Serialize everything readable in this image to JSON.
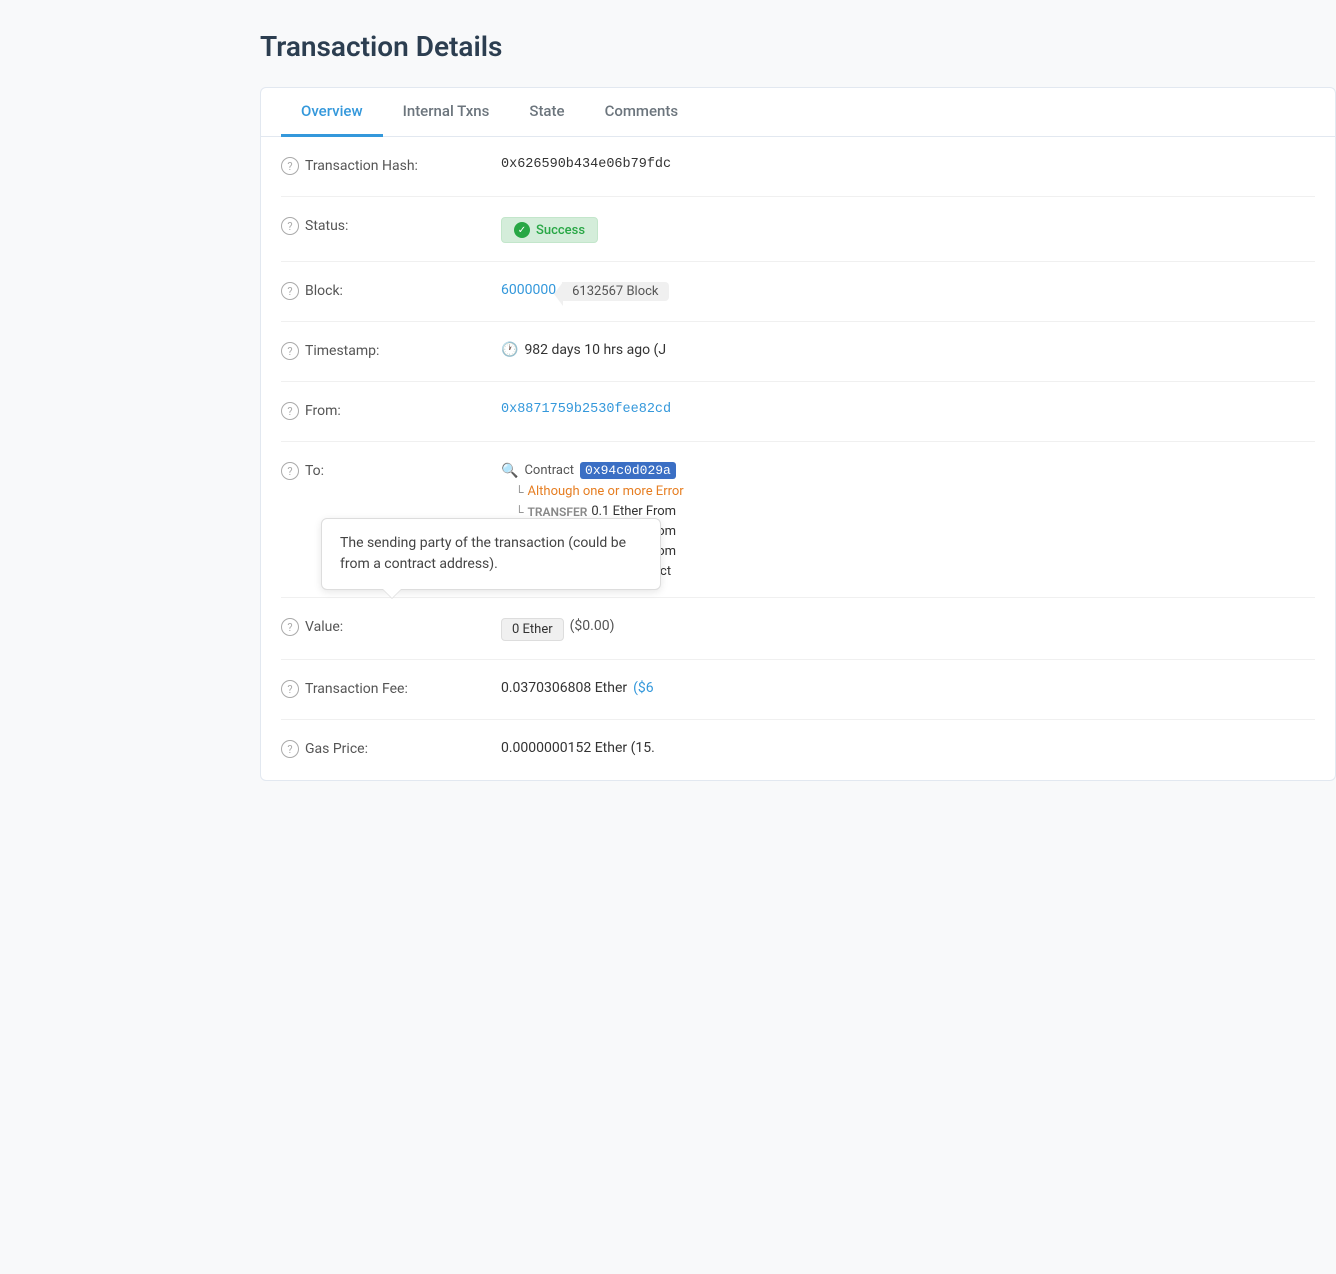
{
  "page": {
    "title": "Transaction Details"
  },
  "tabs": [
    {
      "id": "overview",
      "label": "Overview",
      "active": true
    },
    {
      "id": "internal-txns",
      "label": "Internal Txns",
      "active": false
    },
    {
      "id": "state",
      "label": "State",
      "active": false
    },
    {
      "id": "comments",
      "label": "Comments",
      "active": false
    }
  ],
  "fields": {
    "transaction_hash": {
      "label": "Transaction Hash:",
      "value": "0x626590b434e06b79fdc"
    },
    "status": {
      "label": "Status:",
      "value": "Success"
    },
    "block": {
      "label": "Block:",
      "block_number": "6000000",
      "confirmations": "6132567 Block"
    },
    "timestamp": {
      "label": "Timestamp:",
      "value": "982 days 10 hrs ago (J"
    },
    "from": {
      "label": "From:",
      "value": "0x8871759b2530fee82cd"
    },
    "to": {
      "label": "To:",
      "contract_label": "Contract",
      "contract_address": "0x94c0d029a",
      "error_note": "Although one or more Error",
      "transfers": [
        {
          "type": "TRANSFER",
          "amount": "0.1 Ether From"
        },
        {
          "type": "TRANSFER",
          "amount": "0.1 Ether From"
        },
        {
          "type": "TRANSFER",
          "amount": "0.1 Ether From"
        },
        {
          "type": "SELF DESTRUCT",
          "amount": "Contract"
        }
      ]
    },
    "value": {
      "label": "Value:",
      "amount": "0 Ether",
      "usd": "($0.00)"
    },
    "transaction_fee": {
      "label": "Transaction Fee:",
      "amount": "0.0370306808 Ether",
      "usd": "($6"
    },
    "gas_price": {
      "label": "Gas Price:",
      "amount": "0.0000000152 Ether (15."
    }
  },
  "tooltip": {
    "text": "The sending party of the transaction (could be from a contract address)."
  }
}
